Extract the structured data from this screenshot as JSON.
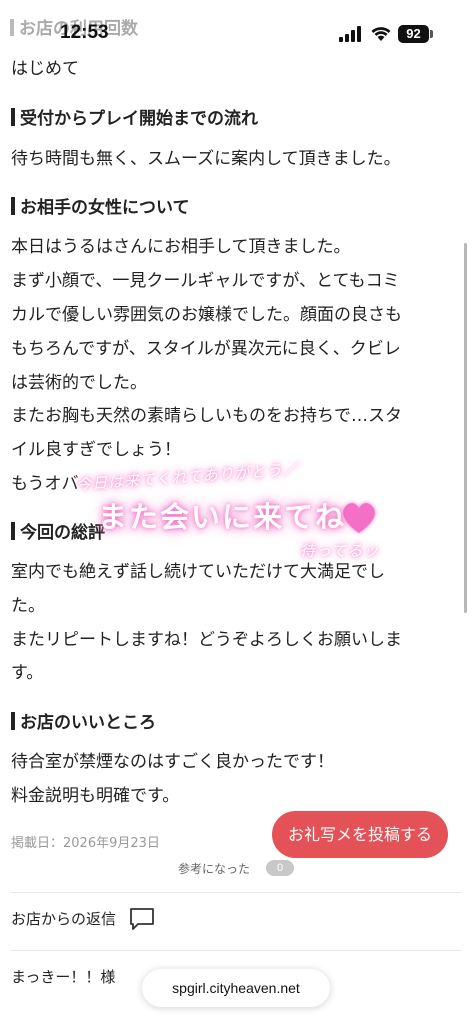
{
  "status": {
    "time": "12:53",
    "battery": "92"
  },
  "peek_heading": "お店の利用回数",
  "first_visit": "はじめて",
  "sections": {
    "flow_title": "受付からプレイ開始までの流れ",
    "flow_text": "待ち時間も無く、スムーズに案内して頂きました。",
    "woman_title": "お相手の女性について",
    "woman_lines": [
      "本日はうるはさんにお相手して頂きました。",
      "まず小顔で、一見クールギャルですが、とてもコミ",
      "カルで優しい雰囲気のお嬢様でした。顔面の良さも",
      "もちろんですが、スタイルが異次元に良く、クビレ",
      "は芸術的でした。",
      "またお胸も天然の素晴らしいものをお持ちで…スタ",
      "イル良すぎでしょう！",
      "もうオバ"
    ],
    "summary_title": "今回の総評",
    "summary_lines": [
      "室内でも絶えず話し続けていただけて大満足でし",
      "た。",
      "またリピートしますね！どうぞよろしくお願いしま",
      "す。"
    ],
    "shop_title": "お店のいいところ",
    "shop_lines": [
      "待合室が禁煙なのはすごく良かったです！",
      "料金説明も明確です。"
    ]
  },
  "overlay": {
    "top": "今日は来てくれてありがとう／",
    "main": "また会いに来てね",
    "bottom": "待ってるッ"
  },
  "meta": {
    "posted": "掲載日：2026年9月23日",
    "cta": "お礼写メを投稿する",
    "helpful_label": "参考になった",
    "helpful_count": "0"
  },
  "reply": {
    "label": "お店からの返信",
    "name": "まっきー！！様"
  },
  "browser": {
    "url": "spgirl.cityheaven.net"
  },
  "colors": {
    "cta": "#e45257",
    "overlay_glow": "#f272c7"
  }
}
